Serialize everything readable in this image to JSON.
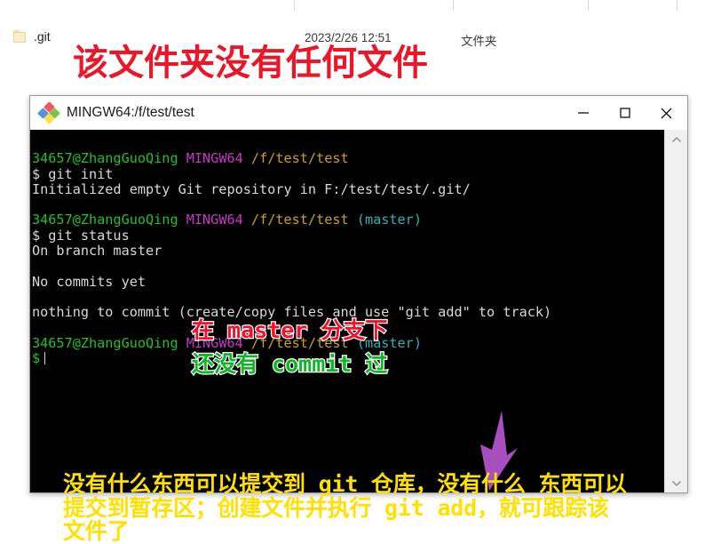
{
  "explorer": {
    "file_row": {
      "icon": "folder-icon",
      "name": ".git",
      "date_modified": "2023/2/26 12:51",
      "type": "文件夹"
    },
    "annotation": "该文件夹没有任何文件",
    "annotation_color": "#e8172a"
  },
  "terminal": {
    "title": "MINGW64:/f/test/test",
    "icon": "mingw-diamond-icon",
    "controls": {
      "minimize": "minimize-icon",
      "maximize": "maximize-icon",
      "close": "close-icon"
    },
    "prompt_user": "34657@ZhangGuoQing",
    "prompt_shell": "MINGW64",
    "prompt_path": "/f/test/test",
    "prompt_branch": "(master)",
    "lines": {
      "cmd1": "$ git init",
      "out1": "Initialized empty Git repository in F:/test/test/.git/",
      "cmd2": "$ git status",
      "out2": "On branch master",
      "out3": "No commits yet",
      "out4": "nothing to commit (create/copy files and use \"git add\" to track)",
      "prompt_final": "$"
    },
    "scrollbar": {
      "up_arrow": "chevron-up-icon",
      "down_arrow": "chevron-down-icon"
    },
    "colors": {
      "background": "#000000",
      "user": "#24c024",
      "shell": "#c838c8",
      "path": "#c8a415",
      "branch": "#2fb3b3",
      "text": "#d4d4d4"
    }
  },
  "annotations": {
    "master_note": "在 master 分支下",
    "master_note_color": "#f3102a",
    "commit_note": "还没有 commit 过",
    "commit_note_color": "#12b528",
    "bottom_note": "没有什么东西可以提交到 git 仓库，没有什么 东西可以\n提交到暂存区；创建文件并执行 git add，就可跟踪该\n文件了",
    "bottom_note_color": "#ffe000",
    "arrow": "down-arrow-annotation",
    "arrow_color": "#a84fc0"
  }
}
